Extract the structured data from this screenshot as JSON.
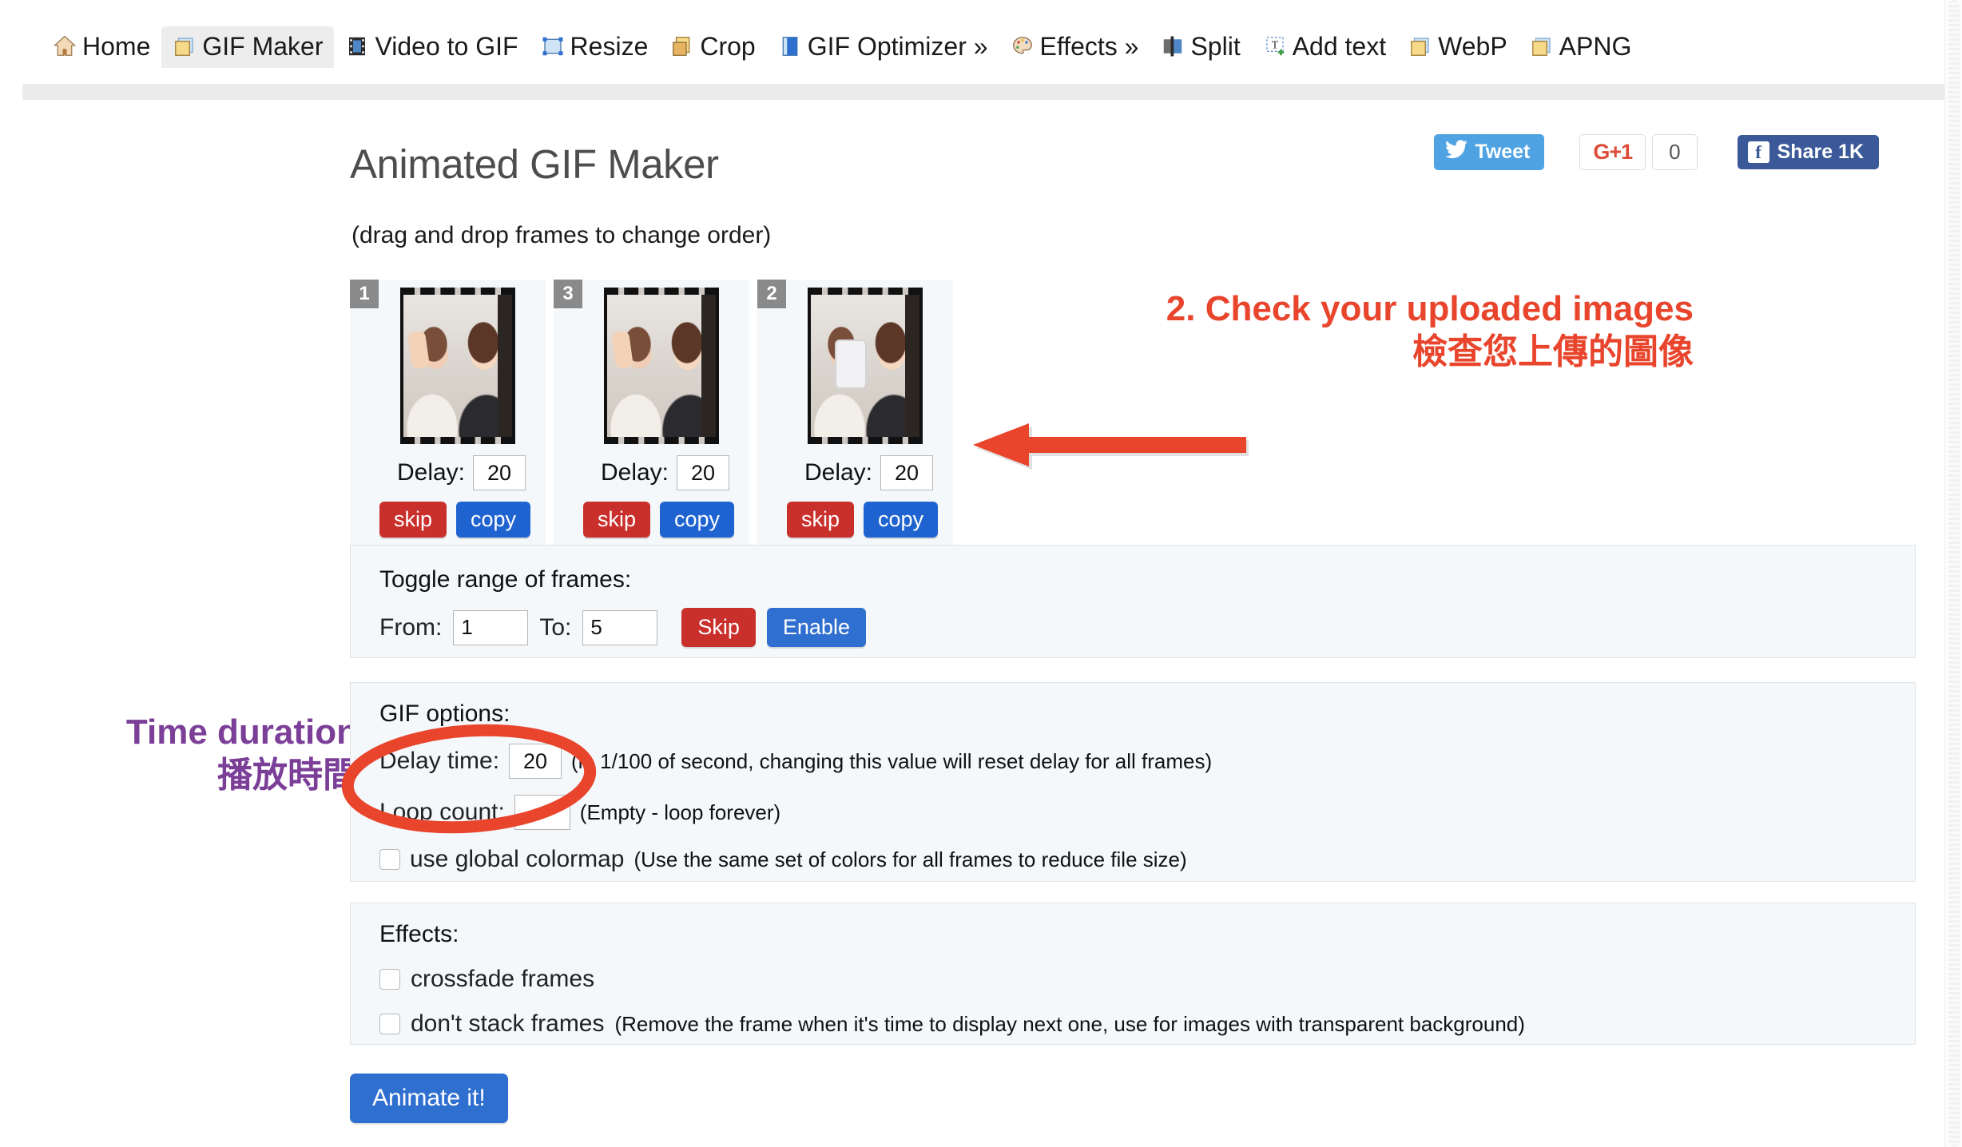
{
  "nav": {
    "tabs": [
      {
        "label": "Home",
        "icon": "house-icon",
        "active": false
      },
      {
        "label": "GIF Maker",
        "icon": "gif-maker-icon",
        "active": true
      },
      {
        "label": "Video to GIF",
        "icon": "film-strip-icon",
        "active": false
      },
      {
        "label": "Resize",
        "icon": "resize-icon",
        "active": false
      },
      {
        "label": "Crop",
        "icon": "crop-icon",
        "active": false
      },
      {
        "label": "GIF Optimizer »",
        "icon": "optimizer-icon",
        "active": false
      },
      {
        "label": "Effects »",
        "icon": "palette-icon",
        "active": false
      },
      {
        "label": "Split",
        "icon": "split-icon",
        "active": false
      },
      {
        "label": "Add text",
        "icon": "add-text-icon",
        "active": false
      },
      {
        "label": "WebP",
        "icon": "webp-icon",
        "active": false
      },
      {
        "label": "APNG",
        "icon": "apng-icon",
        "active": false
      }
    ]
  },
  "header": {
    "title": "Animated GIF Maker",
    "subtitle": "(drag and drop frames to change order)"
  },
  "social": {
    "tweet_label": "Tweet",
    "gplus_label": "G+1",
    "gplus_count": "0",
    "facebook_label": "Share 1K"
  },
  "frames": {
    "delay_label": "Delay:",
    "skip_label": "skip",
    "copy_label": "copy",
    "items": [
      {
        "number": "1",
        "delay": "20",
        "variant": "peace"
      },
      {
        "number": "3",
        "delay": "20",
        "variant": "peace"
      },
      {
        "number": "2",
        "delay": "20",
        "variant": "phone"
      }
    ]
  },
  "toggle_range": {
    "title": "Toggle range of frames:",
    "from_label": "From:",
    "from_value": "1",
    "to_label": "To:",
    "to_value": "5",
    "skip_label": "Skip",
    "enable_label": "Enable"
  },
  "gif_options": {
    "title": "GIF options:",
    "delay_time_label": "Delay time:",
    "delay_time_value": "20",
    "delay_time_hint": "(in 1/100 of second, changing this value will reset delay for all frames)",
    "loop_count_label": "Loop count:",
    "loop_count_value": "",
    "loop_count_hint": "(Empty - loop forever)",
    "global_colormap_label": "use global colormap",
    "global_colormap_hint": "(Use the same set of colors for all frames to reduce file size)"
  },
  "effects": {
    "title": "Effects:",
    "crossfade_label": "crossfade frames",
    "dont_stack_label": "don't stack frames",
    "dont_stack_hint": "(Remove the frame when it's time to display next one, use for images with transparent background)"
  },
  "actions": {
    "animate_label": "Animate it!"
  },
  "annotations": {
    "check_en": "2. Check your uploaded images",
    "check_zh": "檢查您上傳的圖像",
    "time_en": "Time duration",
    "time_zh": "播放時間",
    "arrow": "left-arrow-annotation",
    "ellipse": "red-ellipse-annotation"
  },
  "colors": {
    "annotation_red": "#e8452c",
    "annotation_purple": "#7b3f98",
    "primary_blue": "#2f6fd0",
    "danger_red": "#c9302c",
    "panel_bg": "#f4f8fb"
  }
}
